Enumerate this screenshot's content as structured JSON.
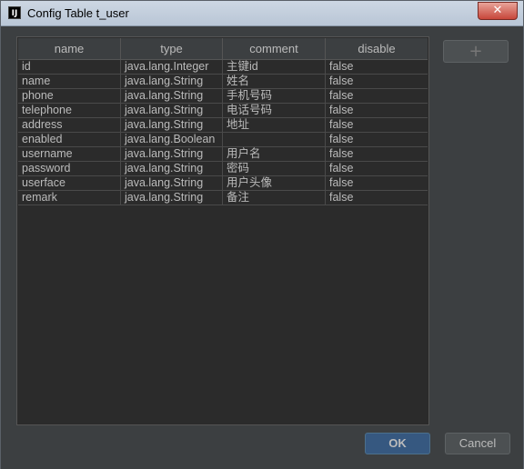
{
  "window": {
    "title": "Config Table t_user",
    "app_icon": "IJ",
    "close_glyph": "✕"
  },
  "table": {
    "columns": [
      "name",
      "type",
      "comment",
      "disable"
    ],
    "rows": [
      [
        "id",
        "java.lang.Integer",
        "主键id",
        "false"
      ],
      [
        "name",
        "java.lang.String",
        "姓名",
        "false"
      ],
      [
        "phone",
        "java.lang.String",
        "手机号码",
        "false"
      ],
      [
        "telephone",
        "java.lang.String",
        "电话号码",
        "false"
      ],
      [
        "address",
        "java.lang.String",
        "地址",
        "false"
      ],
      [
        "enabled",
        "java.lang.Boolean",
        "",
        "false"
      ],
      [
        "username",
        "java.lang.String",
        "用户名",
        "false"
      ],
      [
        "password",
        "java.lang.String",
        "密码",
        "false"
      ],
      [
        "userface",
        "java.lang.String",
        "用户头像",
        "false"
      ],
      [
        "remark",
        "java.lang.String",
        "备注",
        "false"
      ]
    ]
  },
  "buttons": {
    "add": "+",
    "ok": "OK",
    "cancel": "Cancel"
  },
  "colors": {
    "background": "#3c3f41",
    "table_bg": "#2b2b2b",
    "text": "#bbbbbb",
    "ok_button": "#365880"
  }
}
